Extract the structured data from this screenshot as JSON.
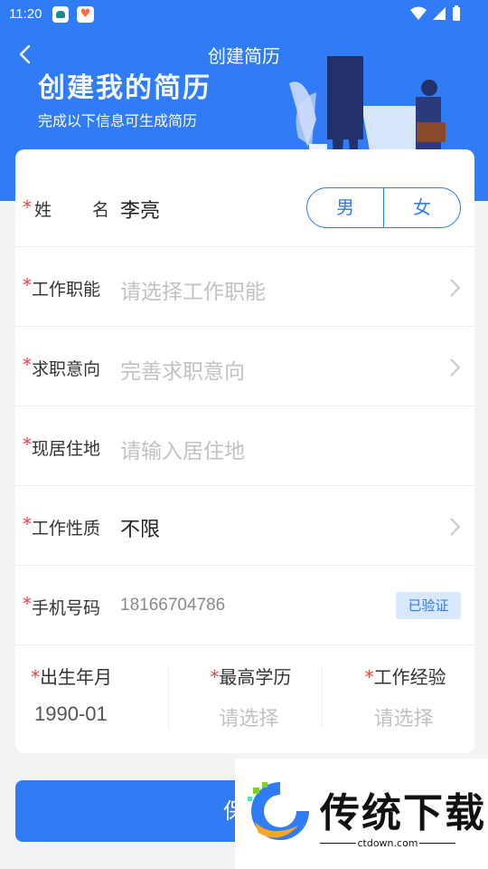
{
  "status_bar": {
    "time": "11:20"
  },
  "header": {
    "title": "创建简历",
    "banner_title": "创建我的简历",
    "banner_subtitle": "完成以下信息可生成简历"
  },
  "form": {
    "name": {
      "label_a": "姓",
      "label_b": "名",
      "value": "李亮"
    },
    "gender": {
      "options": [
        "男",
        "女"
      ]
    },
    "job_function": {
      "label": "工作职能",
      "placeholder": "请选择工作职能"
    },
    "job_intention": {
      "label": "求职意向",
      "placeholder": "完善求职意向"
    },
    "residence": {
      "label": "现居住地",
      "placeholder": "请输入居住地"
    },
    "job_nature": {
      "label": "工作性质",
      "value": "不限"
    },
    "phone": {
      "label": "手机号码",
      "value": "18166704786",
      "badge": "已验证"
    },
    "birth": {
      "label": "出生年月",
      "value": "1990-01"
    },
    "education": {
      "label": "最高学历",
      "placeholder": "请选择"
    },
    "experience": {
      "label": "工作经验",
      "placeholder": "请选择"
    },
    "required_mark": "*"
  },
  "save_button": {
    "label": "保存"
  },
  "watermark": {
    "brand": "传统下载",
    "url": "ctdown.com"
  },
  "colors": {
    "primary": "#2f7cf6",
    "required": "#e8423b",
    "placeholder": "#c2c2c2",
    "badge_bg": "#d9e8fd"
  }
}
